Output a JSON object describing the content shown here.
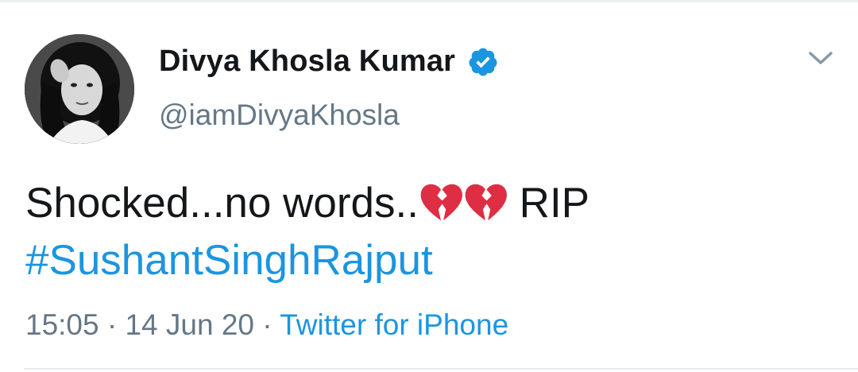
{
  "author": {
    "display_name": "Divya Khosla Kumar",
    "handle": "@iamDivyaKhosla",
    "verified": true
  },
  "tweet": {
    "text_before_emoji": "Shocked...no words..",
    "emojis": [
      "broken-heart",
      "broken-heart"
    ],
    "text_after_emoji": " RIP",
    "hashtag": "#SushantSinghRajput",
    "time": "15:05",
    "separator": " · ",
    "date": "14 Jun 20",
    "source": "Twitter for iPhone"
  },
  "colors": {
    "link_blue": "#1b95e0",
    "text_dark": "#14171a",
    "text_gray": "#657786",
    "heart_red": "#dd2e44"
  },
  "icons": {
    "verified": "verified-badge-icon",
    "more": "chevron-down-icon"
  }
}
